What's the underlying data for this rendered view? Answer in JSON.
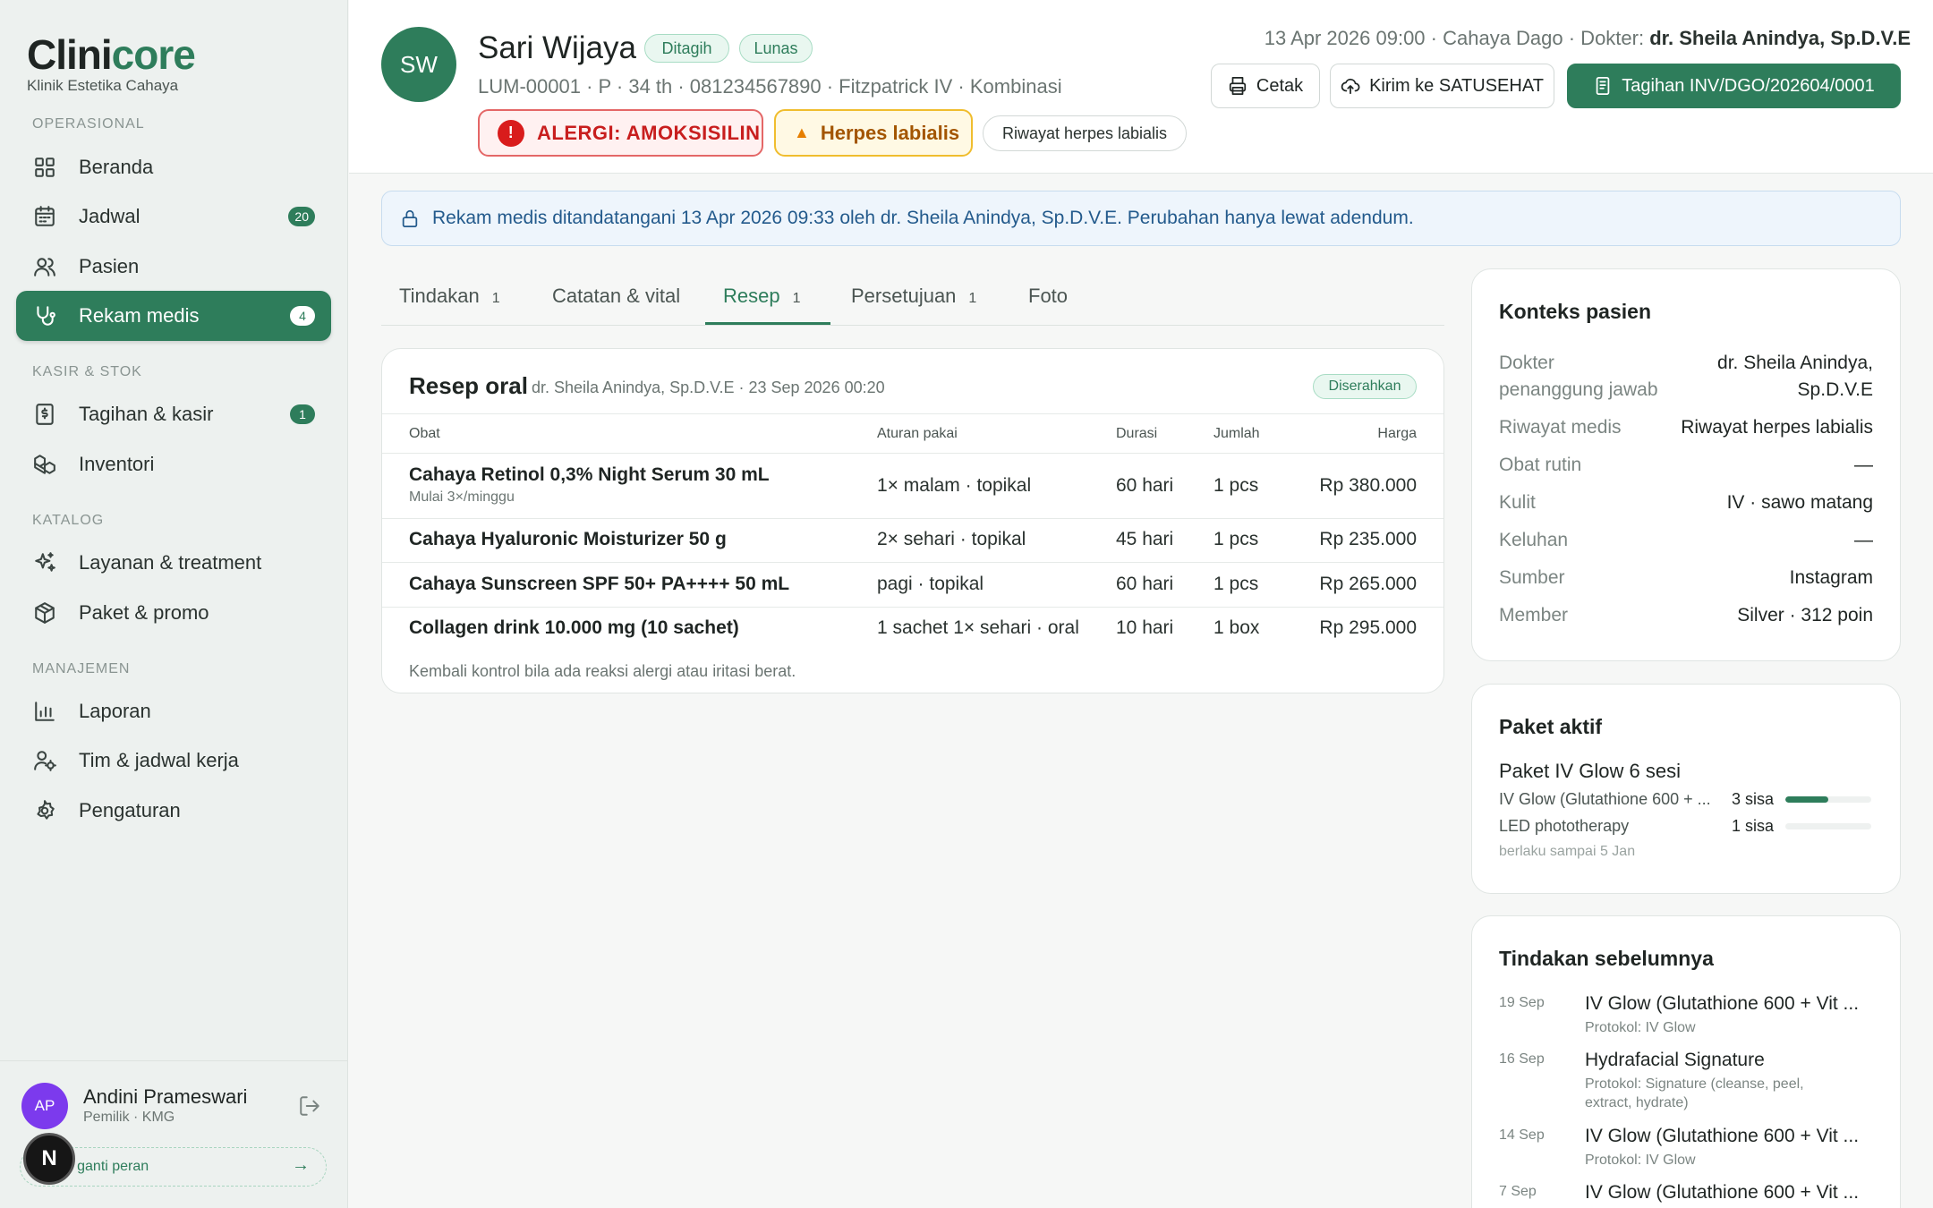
{
  "brand": {
    "name_main": "Clini",
    "name_accent": "core",
    "subtitle": "Klinik Estetika Cahaya"
  },
  "sidebar": {
    "sections": {
      "operasional": "OPERASIONAL",
      "kasir": "KASIR & STOK",
      "katalog": "KATALOG",
      "manajemen": "MANAJEMEN"
    },
    "items": [
      {
        "label": "Beranda",
        "icon": "grid-icon"
      },
      {
        "label": "Jadwal",
        "icon": "calendar-icon",
        "badge": "20"
      },
      {
        "label": "Pasien",
        "icon": "users-icon"
      },
      {
        "label": "Rekam medis",
        "icon": "stethoscope-icon",
        "badge": "4",
        "active": true
      },
      {
        "label": "Tagihan & kasir",
        "icon": "receipt-icon",
        "badge": "1"
      },
      {
        "label": "Inventori",
        "icon": "boxes-icon"
      },
      {
        "label": "Layanan & treatment",
        "icon": "sparkles-icon"
      },
      {
        "label": "Paket & promo",
        "icon": "package-icon"
      },
      {
        "label": "Laporan",
        "icon": "bar-chart-icon"
      },
      {
        "label": "Tim & jadwal kerja",
        "icon": "user-cog-icon"
      },
      {
        "label": "Pengaturan",
        "icon": "settings-icon"
      }
    ]
  },
  "user": {
    "initials": "AP",
    "name": "Andini Prameswari",
    "role": "Pemilik · KMG",
    "demo": "Demo · ganti peran",
    "demo_visible": "o · ganti peran",
    "n_badge": "N"
  },
  "patient": {
    "initials": "SW",
    "name": "Sari Wijaya",
    "tags": [
      "Ditagih",
      "Lunas"
    ],
    "meta": "LUM-00001 · P · 34 th · 081234567890 · Fitzpatrick IV · Kombinasi",
    "allergy": "ALERGI: AMOKSISILIN",
    "warning": "Herpes labialis",
    "history_chip": "Riwayat herpes labialis"
  },
  "appointment": {
    "prefix": "13 Apr 2026 09:00 · Cahaya Dago · Dokter: ",
    "doctor": "dr. Sheila Anindya, Sp.D.V.E"
  },
  "actions": {
    "print": "Cetak",
    "send": "Kirim ke SATUSEHAT",
    "invoice": "Tagihan INV/DGO/202604/0001"
  },
  "banner": "Rekam medis ditandatangani 13 Apr 2026 09:33 oleh dr. Sheila Anindya, Sp.D.V.E. Perubahan hanya lewat adendum.",
  "tabs": [
    {
      "label": "Tindakan",
      "count": "1"
    },
    {
      "label": "Catatan & vital",
      "count": ""
    },
    {
      "label": "Resep",
      "count": "1",
      "active": true
    },
    {
      "label": "Persetujuan",
      "count": "1"
    },
    {
      "label": "Foto",
      "count": ""
    }
  ],
  "prescription": {
    "title": "Resep oral",
    "subtitle": "dr. Sheila Anindya, Sp.D.V.E · 23 Sep 2026 00:20",
    "status": "Diserahkan",
    "columns": [
      "Obat",
      "Aturan pakai",
      "Durasi",
      "Jumlah",
      "Harga"
    ],
    "rows": [
      {
        "drug": "Cahaya Retinol 0,3% Night Serum 30 mL",
        "note": "Mulai 3×/minggu",
        "dose": "1× malam · topikal",
        "duration": "60 hari",
        "qty": "1 pcs",
        "price": "Rp 380.000"
      },
      {
        "drug": "Cahaya Hyaluronic Moisturizer 50 g",
        "note": "",
        "dose": "2× sehari · topikal",
        "duration": "45 hari",
        "qty": "1 pcs",
        "price": "Rp 235.000"
      },
      {
        "drug": "Cahaya Sunscreen SPF 50+ PA++++ 50 mL",
        "note": "",
        "dose": "pagi · topikal",
        "duration": "60 hari",
        "qty": "1 pcs",
        "price": "Rp 265.000"
      },
      {
        "drug": "Collagen drink 10.000 mg (10 sachet)",
        "note": "",
        "dose": "1 sachet 1× sehari · oral",
        "duration": "10 hari",
        "qty": "1 box",
        "price": "Rp 295.000"
      }
    ],
    "footnote": "Kembali kontrol bila ada reaksi alergi atau iritasi berat."
  },
  "context": {
    "title": "Konteks pasien",
    "rows": [
      {
        "label": "Dokter penanggung jawab",
        "label_l1": "Dokter",
        "label_l2": "penanggung jawab",
        "value_l1": "dr. Sheila Anindya,",
        "value_l2": "Sp.D.V.E"
      },
      {
        "label": "Riwayat medis",
        "value": "Riwayat herpes labialis"
      },
      {
        "label": "Obat rutin",
        "value": "—"
      },
      {
        "label": "Kulit",
        "value": "IV · sawo matang"
      },
      {
        "label": "Keluhan",
        "value": "—"
      },
      {
        "label": "Sumber",
        "value": "Instagram"
      },
      {
        "label": "Member",
        "value": "Silver · 312 poin"
      }
    ]
  },
  "package": {
    "title": "Paket aktif",
    "name": "Paket IV Glow 6 sesi",
    "items": [
      {
        "name": "IV Glow (Glutathione 600 + ...",
        "remaining": "3 sisa",
        "progress": 0.5
      },
      {
        "name": "LED phototherapy",
        "remaining": "1 sisa",
        "progress": 0
      }
    ],
    "valid": "berlaku sampai 5 Jan"
  },
  "history": {
    "title": "Tindakan sebelumnya",
    "items": [
      {
        "date": "19 Sep",
        "name": "IV Glow (Glutathione 600 + Vit ...",
        "protocol": "Protokol: IV Glow"
      },
      {
        "date": "16 Sep",
        "name": "Hydrafacial Signature",
        "protocol_l1": "Protokol: Signature (cleanse, peel,",
        "protocol_l2": "extract, hydrate)"
      },
      {
        "date": "14 Sep",
        "name": "IV Glow (Glutathione 600 + Vit ...",
        "protocol": "Protokol: IV Glow"
      },
      {
        "date": "7 Sep",
        "name": "IV Glow (Glutathione 600 + Vit ..."
      }
    ]
  },
  "colors": {
    "brand": "#2e7d5b",
    "danger": "#c81e1e",
    "warning": "#e67e00",
    "info": "#235a8c"
  }
}
